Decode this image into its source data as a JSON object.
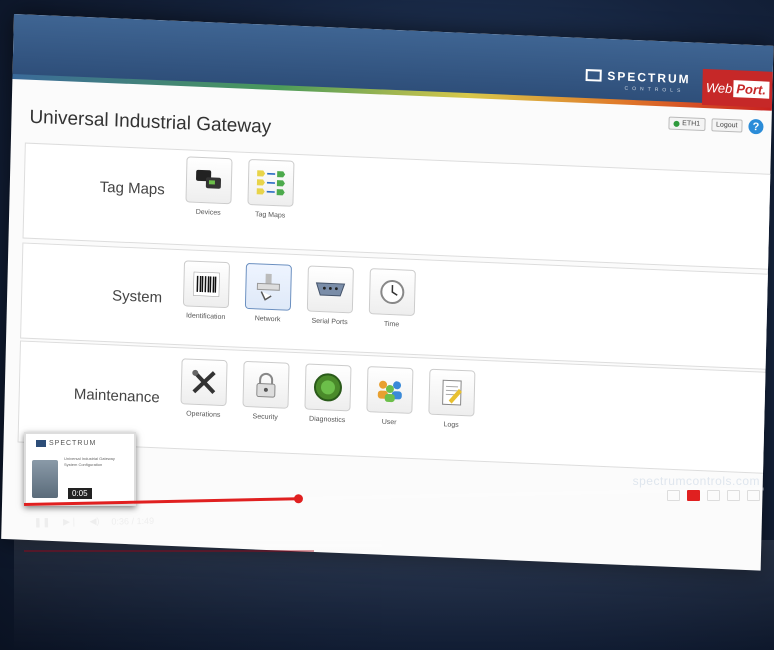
{
  "header": {
    "brand_name": "SPECTRUM",
    "brand_sub": "CONTROLS",
    "webport_pre": "Web",
    "webport_bold": "Port.",
    "eth_label": "ETH1",
    "logout_label": "Logout",
    "help_label": "?"
  },
  "page": {
    "title": "Universal Industrial Gateway"
  },
  "sections": [
    {
      "label": "Tag Maps",
      "tiles": [
        "Devices",
        "Tag Maps"
      ]
    },
    {
      "label": "System",
      "tiles": [
        "Identification",
        "Network",
        "Serial Ports",
        "Time"
      ]
    },
    {
      "label": "Maintenance",
      "tiles": [
        "Operations",
        "Security",
        "Diagnostics",
        "User",
        "Logs"
      ]
    }
  ],
  "player": {
    "thumb_brand": "SPECTRUM",
    "thumb_text": "Universal Industrial Gateway System Configuration",
    "thumb_time": "0:05",
    "time_display": "0:36 / 1:49",
    "watermark": "spectrumcontrols.com",
    "progress": 0.37
  },
  "colors": {
    "accent": "#c62828",
    "header": "#2d4d78",
    "progress": "#e02020"
  }
}
